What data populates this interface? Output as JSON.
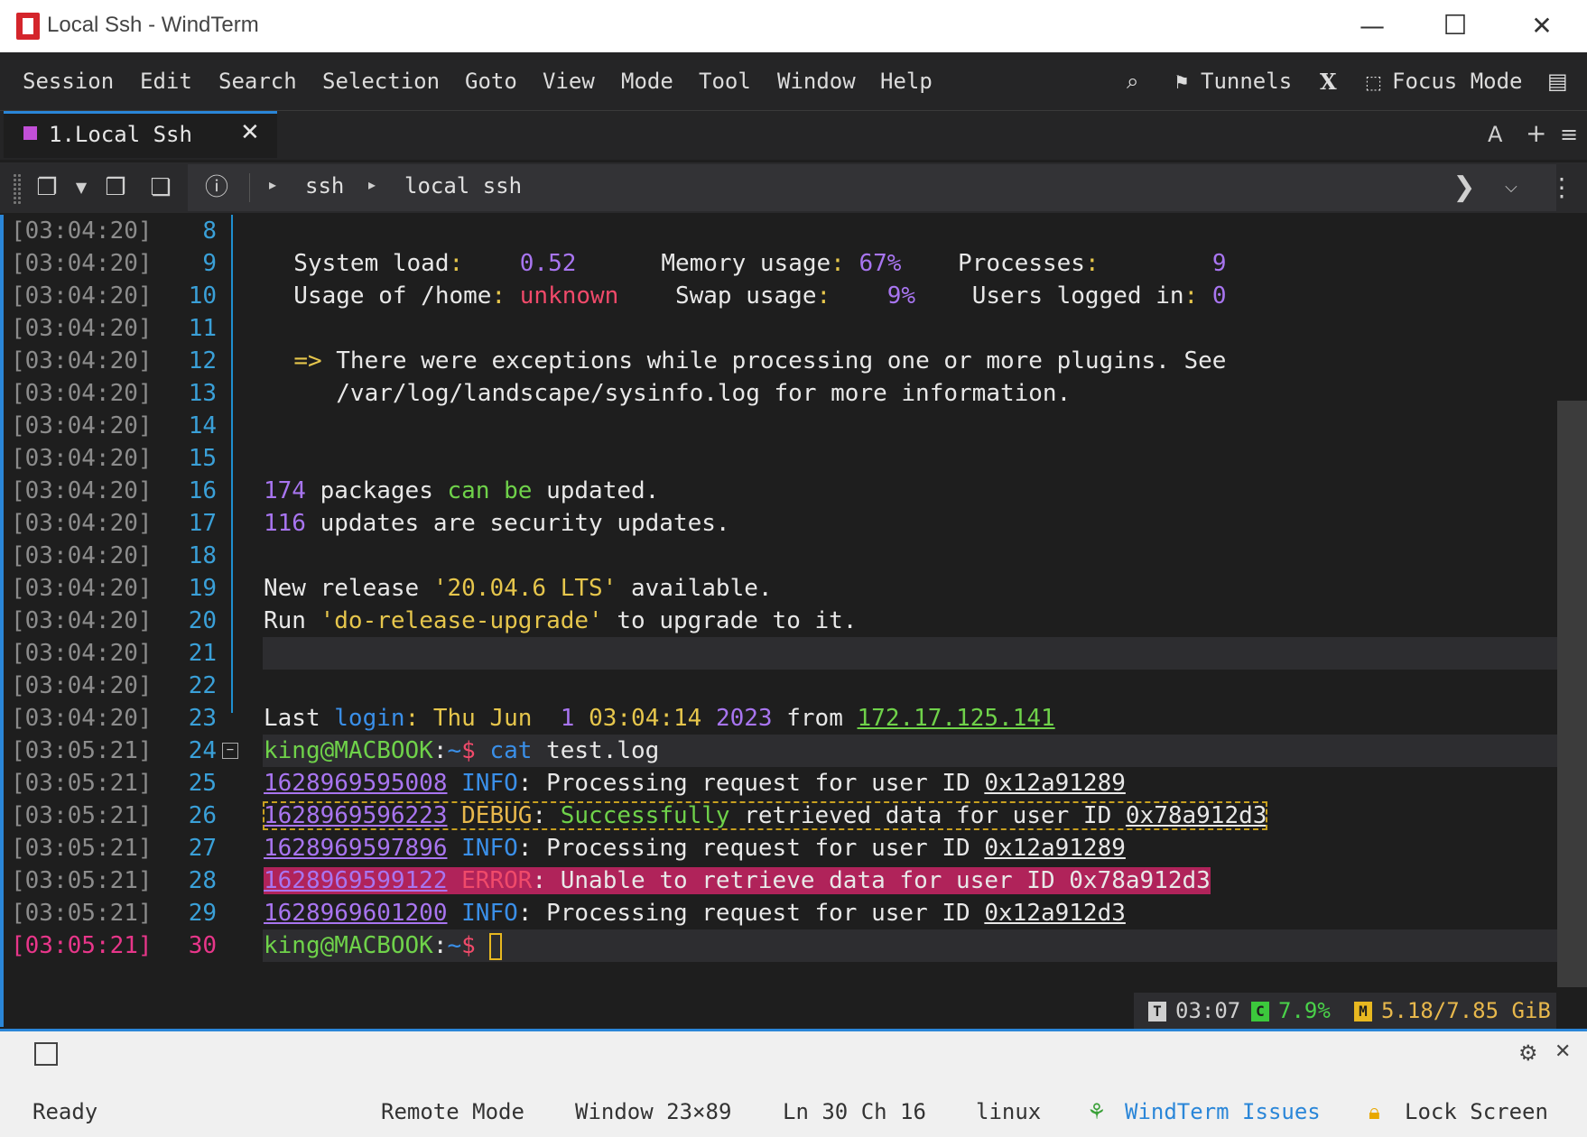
{
  "window": {
    "title": "Local Ssh - WindTerm",
    "minimize": "—",
    "maximize": "☐",
    "close": "✕"
  },
  "menu": {
    "items": [
      "Session",
      "Edit",
      "Search",
      "Selection",
      "Goto",
      "View",
      "Mode",
      "Tool",
      "Window",
      "Help"
    ],
    "tunnels": "Tunnels",
    "x_label": "X",
    "focus_mode": "Focus Mode"
  },
  "tab": {
    "label": "1.Local Ssh",
    "close": "✕",
    "font_btn": "A",
    "add_btn": "+",
    "menu_btn": "≡"
  },
  "breadcrumb": {
    "items": [
      "ssh",
      "local ssh"
    ]
  },
  "terminal": {
    "lines": [
      {
        "ts": "[03:04:20]",
        "n": "8",
        "segs": []
      },
      {
        "ts": "[03:04:20]",
        "n": "9",
        "segs": [
          {
            "t": "  System load",
            "c": ""
          },
          {
            "t": ":",
            "c": "ylw"
          },
          {
            "t": "    0.52      ",
            "c": "pur"
          },
          {
            "t": "Memory usage",
            "c": ""
          },
          {
            "t": ": ",
            "c": "ylw"
          },
          {
            "t": "67%",
            "c": "pur"
          },
          {
            "t": "    Processes",
            "c": ""
          },
          {
            "t": ":",
            "c": "ylw"
          },
          {
            "t": "        9",
            "c": "pur"
          }
        ]
      },
      {
        "ts": "[03:04:20]",
        "n": "10",
        "segs": [
          {
            "t": "  Usage of /home",
            "c": ""
          },
          {
            "t": ": ",
            "c": "ylw"
          },
          {
            "t": "unknown",
            "c": "red"
          },
          {
            "t": "    Swap usage",
            "c": ""
          },
          {
            "t": ":    ",
            "c": "ylw"
          },
          {
            "t": "9%",
            "c": "pur"
          },
          {
            "t": "    Users logged in",
            "c": ""
          },
          {
            "t": ": ",
            "c": "ylw"
          },
          {
            "t": "0",
            "c": "pur"
          }
        ]
      },
      {
        "ts": "[03:04:20]",
        "n": "11",
        "segs": []
      },
      {
        "ts": "[03:04:20]",
        "n": "12",
        "segs": [
          {
            "t": "  ",
            "c": ""
          },
          {
            "t": "=>",
            "c": "ylw"
          },
          {
            "t": " There were exceptions while processing one or more plugins. See",
            "c": ""
          }
        ]
      },
      {
        "ts": "[03:04:20]",
        "n": "13",
        "segs": [
          {
            "t": "     /var/log/landscape/sysinfo.log for more information.",
            "c": ""
          }
        ]
      },
      {
        "ts": "[03:04:20]",
        "n": "14",
        "segs": []
      },
      {
        "ts": "[03:04:20]",
        "n": "15",
        "segs": []
      },
      {
        "ts": "[03:04:20]",
        "n": "16",
        "segs": [
          {
            "t": "174",
            "c": "pur"
          },
          {
            "t": " packages ",
            "c": ""
          },
          {
            "t": "can be",
            "c": "grn"
          },
          {
            "t": " updated.",
            "c": ""
          }
        ]
      },
      {
        "ts": "[03:04:20]",
        "n": "17",
        "segs": [
          {
            "t": "116",
            "c": "pur"
          },
          {
            "t": " updates are security updates.",
            "c": ""
          }
        ]
      },
      {
        "ts": "[03:04:20]",
        "n": "18",
        "segs": []
      },
      {
        "ts": "[03:04:20]",
        "n": "19",
        "segs": [
          {
            "t": "New release ",
            "c": ""
          },
          {
            "t": "'20.04.6 LTS'",
            "c": "ylw"
          },
          {
            "t": " available.",
            "c": ""
          }
        ]
      },
      {
        "ts": "[03:04:20]",
        "n": "20",
        "segs": [
          {
            "t": "Run ",
            "c": ""
          },
          {
            "t": "'do-release-upgrade'",
            "c": "ylw"
          },
          {
            "t": " to upgrade to it.",
            "c": ""
          }
        ]
      },
      {
        "ts": "[03:04:20]",
        "n": "21",
        "segs": []
      },
      {
        "ts": "[03:04:20]",
        "n": "22",
        "segs": []
      },
      {
        "ts": "[03:04:20]",
        "n": "23",
        "segs": [
          {
            "t": "Last ",
            "c": ""
          },
          {
            "t": "login",
            "c": "blu"
          },
          {
            "t": ": ",
            "c": "ylw"
          },
          {
            "t": "Thu Jun  ",
            "c": "ylw"
          },
          {
            "t": "1",
            "c": "pur"
          },
          {
            "t": " ",
            "c": ""
          },
          {
            "t": "03:04:14",
            "c": "ylw"
          },
          {
            "t": " ",
            "c": ""
          },
          {
            "t": "2023",
            "c": "pur"
          },
          {
            "t": " from ",
            "c": ""
          },
          {
            "t": "172.17.125.141",
            "c": "grn ul"
          }
        ]
      },
      {
        "ts": "[03:05:21]",
        "n": "24",
        "segs": [
          {
            "t": "king@MACBOOK",
            "c": "grn"
          },
          {
            "t": ":",
            "c": ""
          },
          {
            "t": "~",
            "c": "blu"
          },
          {
            "t": "$ ",
            "c": "red"
          },
          {
            "t": "cat",
            "c": "blu"
          },
          {
            "t": " test.log",
            "c": ""
          }
        ]
      },
      {
        "ts": "[03:05:21]",
        "n": "25",
        "segs": [
          {
            "t": "1628969595008",
            "c": "pur ul"
          },
          {
            "t": " ",
            "c": ""
          },
          {
            "t": "INFO",
            "c": "blu"
          },
          {
            "t": ": Processing request for user ID ",
            "c": ""
          },
          {
            "t": "0x12a91289",
            "c": "ul"
          }
        ]
      },
      {
        "ts": "[03:05:21]",
        "n": "26",
        "segs": [
          {
            "t": "1628969596223",
            "c": "pur ul"
          },
          {
            "t": " ",
            "c": ""
          },
          {
            "t": "DEBUG",
            "c": "orn"
          },
          {
            "t": ": ",
            "c": ""
          },
          {
            "t": "Successfully",
            "c": "grn"
          },
          {
            "t": " retrieved data for user ID ",
            "c": ""
          },
          {
            "t": "0x78a912d3",
            "c": "ul"
          }
        ]
      },
      {
        "ts": "[03:05:21]",
        "n": "27",
        "segs": [
          {
            "t": "1628969597896",
            "c": "pur ul"
          },
          {
            "t": " ",
            "c": ""
          },
          {
            "t": "INFO",
            "c": "blu"
          },
          {
            "t": ": Processing request for user ID ",
            "c": ""
          },
          {
            "t": "0x12a91289",
            "c": "ul"
          }
        ]
      },
      {
        "ts": "[03:05:21]",
        "n": "28",
        "segs": [
          {
            "t": "1628969599122",
            "c": "pur ul"
          },
          {
            "t": " ",
            "c": ""
          },
          {
            "t": "ERROR",
            "c": "red"
          },
          {
            "t": ": Unable to retrieve data for user ID 0x78a912d3",
            "c": ""
          }
        ]
      },
      {
        "ts": "[03:05:21]",
        "n": "29",
        "segs": [
          {
            "t": "1628969601200",
            "c": "pur ul"
          },
          {
            "t": " ",
            "c": ""
          },
          {
            "t": "INFO",
            "c": "blu"
          },
          {
            "t": ": Processing request for user ID ",
            "c": ""
          },
          {
            "t": "0x12a912d3",
            "c": "ul"
          }
        ]
      },
      {
        "ts": "[03:05:21]",
        "n": "30",
        "segs": [
          {
            "t": "king@MACBOOK",
            "c": "grn"
          },
          {
            "t": ":",
            "c": ""
          },
          {
            "t": "~",
            "c": "blu"
          },
          {
            "t": "$ ",
            "c": "red"
          }
        ]
      }
    ]
  },
  "mini_status": {
    "t_badge": "T",
    "time": "03:07",
    "c_badge": "C",
    "cpu": "7.9%",
    "m_badge": "M",
    "mem": "5.18/7.85 GiB"
  },
  "status": {
    "ready": "Ready",
    "mode": "Remote Mode",
    "window": "Window 23×89",
    "pos": "Ln 30 Ch 16",
    "os": "linux",
    "issues": "WindTerm Issues",
    "lock": "Lock Screen"
  },
  "colors": {
    "accent": "#2a86d8",
    "error_bg": "#b0235a",
    "purple": "#a875f0",
    "green": "#6fd24a"
  }
}
